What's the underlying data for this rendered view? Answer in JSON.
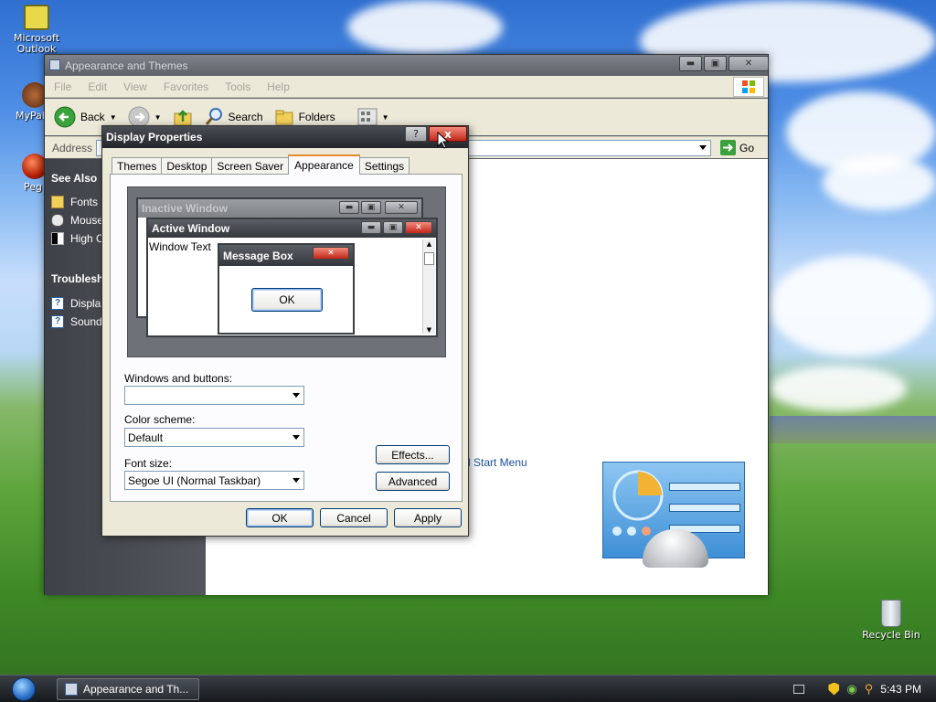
{
  "desktop": {
    "icons": [
      {
        "label": "Microsoft Outlook"
      },
      {
        "label": "MyPal"
      },
      {
        "label": "Peg"
      },
      {
        "label": "Recycle Bin"
      }
    ]
  },
  "explorer": {
    "title": "Appearance and Themes",
    "menu": [
      "File",
      "Edit",
      "View",
      "Favorites",
      "Tools",
      "Help"
    ],
    "toolbar": {
      "back": "Back",
      "search": "Search",
      "folders": "Folders"
    },
    "address_label": "Address",
    "go_label": "Go",
    "left_panel": {
      "see_also": {
        "header": "See Also",
        "items": [
          "Fonts",
          "Mouse",
          "High C"
        ]
      },
      "troubleshooters": {
        "header": "Troubleshoo",
        "items": [
          "Displa",
          "Sound"
        ]
      }
    },
    "content_link": "d Start Menu"
  },
  "dialog": {
    "title": "Display Properties",
    "help_label": "?",
    "close_label": "x",
    "tabs": [
      "Themes",
      "Desktop",
      "Screen Saver",
      "Appearance",
      "Settings"
    ],
    "active_tab": "Appearance",
    "preview": {
      "inactive_window": "Inactive Window",
      "active_window": "Active Window",
      "window_text": "Window Text",
      "message_box": "Message Box",
      "ok": "OK"
    },
    "windows_and_buttons": {
      "label": "Windows and buttons:",
      "value": ""
    },
    "color_scheme": {
      "label": "Color scheme:",
      "value": "Default"
    },
    "font_size": {
      "label": "Font size:",
      "value": "Segoe UI (Normal Taskbar)"
    },
    "effects_label": "Effects...",
    "advanced_label": "Advanced",
    "ok_label": "OK",
    "cancel_label": "Cancel",
    "apply_label": "Apply"
  },
  "taskbar": {
    "task_button": "Appearance and Th...",
    "clock": "5:43 PM"
  },
  "colors": {
    "accent_orange": "#e68b2c",
    "close_red": "#c1261a",
    "link_blue": "#1a4fa0"
  }
}
